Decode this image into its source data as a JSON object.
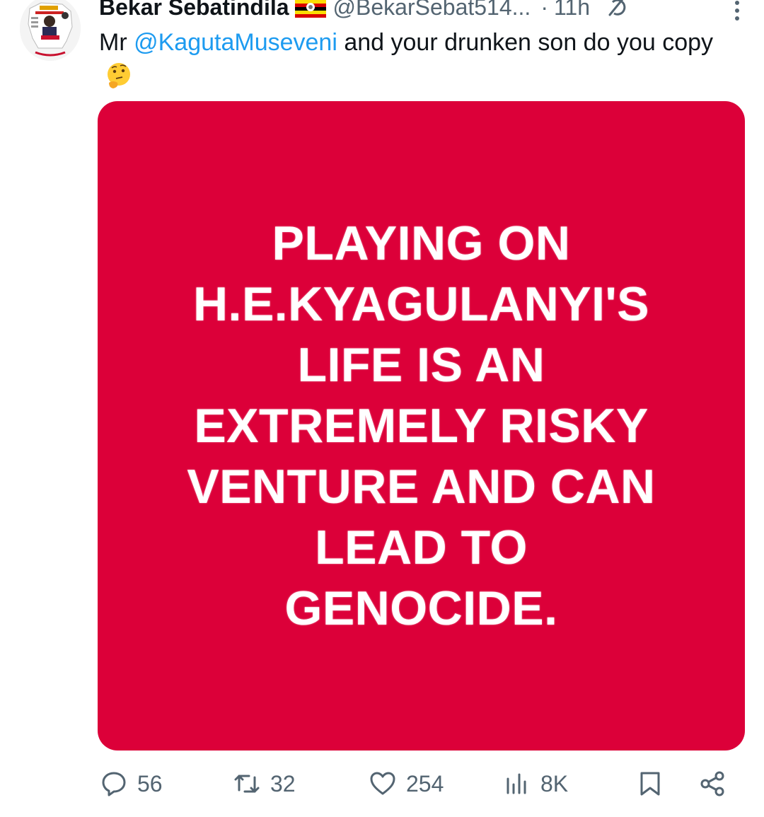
{
  "tweet": {
    "author": {
      "display_name": "Bekar Sebatindila",
      "flag_icon": "uganda-flag-icon",
      "handle": "@BekarSebat514...",
      "time": "11h"
    },
    "text": {
      "prefix": "Mr ",
      "mention": "@KagutaMuseveni",
      "suffix": " and your drunken son do you copy",
      "emoji": "thinking-face-icon"
    },
    "media": {
      "background_color": "#dc0039",
      "text": "PLAYING ON\nH.E.KYAGULANYI'S\nLIFE IS AN\nEXTREMELY RISKY\nVENTURE  AND CAN\nLEAD TO\nGENOCIDE."
    },
    "actions": {
      "replies": "56",
      "reposts": "32",
      "likes": "254",
      "views": "8K"
    }
  },
  "colors": {
    "accent": "#1d9bf0",
    "secondary_text": "#536471",
    "media_red": "#dc0039"
  }
}
